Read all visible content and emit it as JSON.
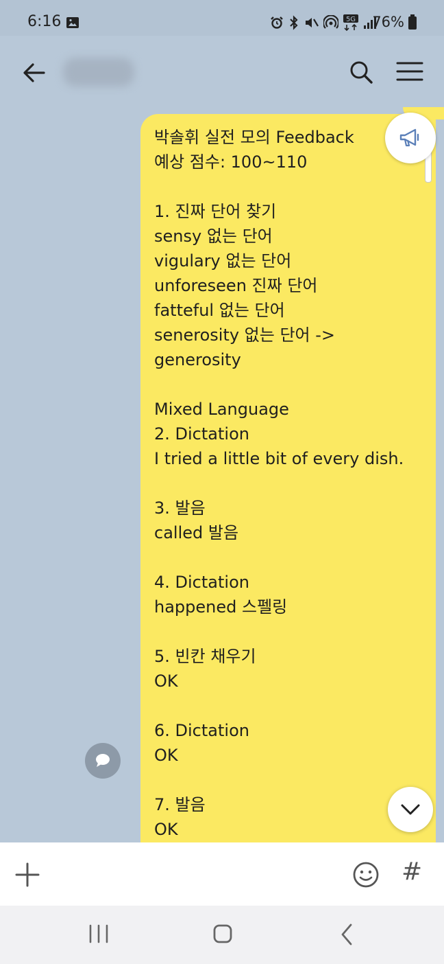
{
  "status_bar": {
    "time": "6:16",
    "network": "5G",
    "battery": "76%"
  },
  "header": {
    "back_icon": "arrow-left-icon",
    "search_icon": "search-icon",
    "menu_icon": "hamburger-menu-icon"
  },
  "message": {
    "text": "박솔휘 실전 모의 Feedback\n예상 점수: 100~110\n\n1. 진짜 단어 찾기\nsensy 없는 단어\nvigulary 없는 단어\nunforeseen 진짜 단어\nfatteful 없는 단어\nsenerosity 없는 단어 ->\ngenerosity\n\nMixed Language\n2. Dictation\nI tried a little bit of every dish.\n\n3. 발음\ncalled 발음\n\n4. Dictation\nhappened 스펠링\n\n5. 빈칸 채우기\nOK\n\n6. Dictation\nOK\n\n7. 발음\nOK",
    "background": "#fbe962"
  },
  "chat": {
    "background": "#b8c8d8",
    "announce_icon": "megaphone-icon",
    "comment_icon": "speech-bubble-icon",
    "scroll_down_icon": "chevron-down-icon"
  },
  "input_bar": {
    "value": "",
    "placeholder": "",
    "plus_icon": "plus-icon",
    "emoji_icon": "emoji-icon",
    "hash_label": "#"
  },
  "nav_bar": {
    "recent_icon": "recent-apps-icon",
    "home_icon": "home-icon",
    "back_icon": "back-icon"
  }
}
